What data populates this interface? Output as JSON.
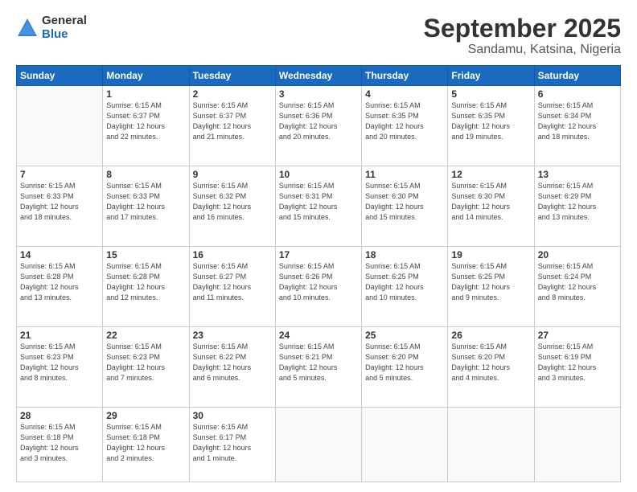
{
  "logo": {
    "general": "General",
    "blue": "Blue"
  },
  "header": {
    "month": "September 2025",
    "location": "Sandamu, Katsina, Nigeria"
  },
  "weekdays": [
    "Sunday",
    "Monday",
    "Tuesday",
    "Wednesday",
    "Thursday",
    "Friday",
    "Saturday"
  ],
  "weeks": [
    [
      {
        "day": "",
        "info": ""
      },
      {
        "day": "1",
        "info": "Sunrise: 6:15 AM\nSunset: 6:37 PM\nDaylight: 12 hours\nand 22 minutes."
      },
      {
        "day": "2",
        "info": "Sunrise: 6:15 AM\nSunset: 6:37 PM\nDaylight: 12 hours\nand 21 minutes."
      },
      {
        "day": "3",
        "info": "Sunrise: 6:15 AM\nSunset: 6:36 PM\nDaylight: 12 hours\nand 20 minutes."
      },
      {
        "day": "4",
        "info": "Sunrise: 6:15 AM\nSunset: 6:35 PM\nDaylight: 12 hours\nand 20 minutes."
      },
      {
        "day": "5",
        "info": "Sunrise: 6:15 AM\nSunset: 6:35 PM\nDaylight: 12 hours\nand 19 minutes."
      },
      {
        "day": "6",
        "info": "Sunrise: 6:15 AM\nSunset: 6:34 PM\nDaylight: 12 hours\nand 18 minutes."
      }
    ],
    [
      {
        "day": "7",
        "info": "Sunrise: 6:15 AM\nSunset: 6:33 PM\nDaylight: 12 hours\nand 18 minutes."
      },
      {
        "day": "8",
        "info": "Sunrise: 6:15 AM\nSunset: 6:33 PM\nDaylight: 12 hours\nand 17 minutes."
      },
      {
        "day": "9",
        "info": "Sunrise: 6:15 AM\nSunset: 6:32 PM\nDaylight: 12 hours\nand 16 minutes."
      },
      {
        "day": "10",
        "info": "Sunrise: 6:15 AM\nSunset: 6:31 PM\nDaylight: 12 hours\nand 15 minutes."
      },
      {
        "day": "11",
        "info": "Sunrise: 6:15 AM\nSunset: 6:30 PM\nDaylight: 12 hours\nand 15 minutes."
      },
      {
        "day": "12",
        "info": "Sunrise: 6:15 AM\nSunset: 6:30 PM\nDaylight: 12 hours\nand 14 minutes."
      },
      {
        "day": "13",
        "info": "Sunrise: 6:15 AM\nSunset: 6:29 PM\nDaylight: 12 hours\nand 13 minutes."
      }
    ],
    [
      {
        "day": "14",
        "info": "Sunrise: 6:15 AM\nSunset: 6:28 PM\nDaylight: 12 hours\nand 13 minutes."
      },
      {
        "day": "15",
        "info": "Sunrise: 6:15 AM\nSunset: 6:28 PM\nDaylight: 12 hours\nand 12 minutes."
      },
      {
        "day": "16",
        "info": "Sunrise: 6:15 AM\nSunset: 6:27 PM\nDaylight: 12 hours\nand 11 minutes."
      },
      {
        "day": "17",
        "info": "Sunrise: 6:15 AM\nSunset: 6:26 PM\nDaylight: 12 hours\nand 10 minutes."
      },
      {
        "day": "18",
        "info": "Sunrise: 6:15 AM\nSunset: 6:25 PM\nDaylight: 12 hours\nand 10 minutes."
      },
      {
        "day": "19",
        "info": "Sunrise: 6:15 AM\nSunset: 6:25 PM\nDaylight: 12 hours\nand 9 minutes."
      },
      {
        "day": "20",
        "info": "Sunrise: 6:15 AM\nSunset: 6:24 PM\nDaylight: 12 hours\nand 8 minutes."
      }
    ],
    [
      {
        "day": "21",
        "info": "Sunrise: 6:15 AM\nSunset: 6:23 PM\nDaylight: 12 hours\nand 8 minutes."
      },
      {
        "day": "22",
        "info": "Sunrise: 6:15 AM\nSunset: 6:23 PM\nDaylight: 12 hours\nand 7 minutes."
      },
      {
        "day": "23",
        "info": "Sunrise: 6:15 AM\nSunset: 6:22 PM\nDaylight: 12 hours\nand 6 minutes."
      },
      {
        "day": "24",
        "info": "Sunrise: 6:15 AM\nSunset: 6:21 PM\nDaylight: 12 hours\nand 5 minutes."
      },
      {
        "day": "25",
        "info": "Sunrise: 6:15 AM\nSunset: 6:20 PM\nDaylight: 12 hours\nand 5 minutes."
      },
      {
        "day": "26",
        "info": "Sunrise: 6:15 AM\nSunset: 6:20 PM\nDaylight: 12 hours\nand 4 minutes."
      },
      {
        "day": "27",
        "info": "Sunrise: 6:15 AM\nSunset: 6:19 PM\nDaylight: 12 hours\nand 3 minutes."
      }
    ],
    [
      {
        "day": "28",
        "info": "Sunrise: 6:15 AM\nSunset: 6:18 PM\nDaylight: 12 hours\nand 3 minutes."
      },
      {
        "day": "29",
        "info": "Sunrise: 6:15 AM\nSunset: 6:18 PM\nDaylight: 12 hours\nand 2 minutes."
      },
      {
        "day": "30",
        "info": "Sunrise: 6:15 AM\nSunset: 6:17 PM\nDaylight: 12 hours\nand 1 minute."
      },
      {
        "day": "",
        "info": ""
      },
      {
        "day": "",
        "info": ""
      },
      {
        "day": "",
        "info": ""
      },
      {
        "day": "",
        "info": ""
      }
    ]
  ]
}
